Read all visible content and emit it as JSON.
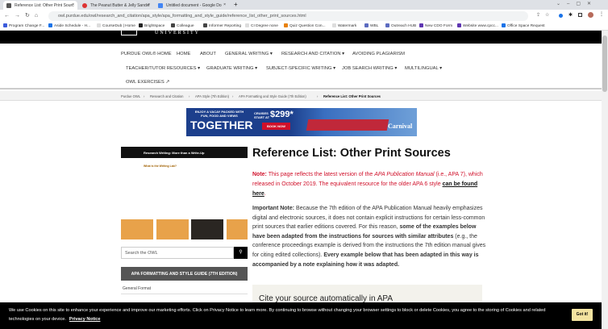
{
  "browser": {
    "tabs": [
      {
        "label": "Reference List: Other Print Sourc",
        "color": "#555"
      },
      {
        "label": "The Peanut Butter & Jelly Sandw",
        "color": "#d33"
      },
      {
        "label": "Untitled document - Google Do",
        "color": "#4285f4"
      }
    ],
    "url": "owl.purdue.edu/owl/research_and_citation/apa_style/apa_formatting_and_style_guide/reference_list_other_print_sources.html",
    "bookmarks": [
      "Program Change F...",
      "Aside Schedule - H...",
      "CourseDub | Home",
      "Brightspace",
      "Colleague",
      "Informer Reporting",
      "CI Degree none",
      "Quiz Question Con...",
      "Watermark",
      "WBL",
      "Outreach HUB",
      "New CDO Form",
      "Website www.cpcc...",
      "Office Space Request"
    ]
  },
  "header": {
    "logo": "UNIVERSITY"
  },
  "nav": {
    "row1": [
      "PURDUE OWL® HOME",
      "HOME",
      "ABOUT",
      "GENERAL WRITING ▾",
      "RESEARCH AND CITATION ▾",
      "AVOIDING PLAGIARISM"
    ],
    "row2": [
      "TEACHER/TUTOR RESOURCES ▾",
      "GRADUATE WRITING ▾",
      "SUBJECT-SPECIFIC WRITING ▾",
      "JOB SEARCH WRITING ▾",
      "MULTILINGUAL ▾"
    ],
    "row3": [
      "OWL EXERCISES ↗"
    ]
  },
  "breadcrumb": [
    "Purdue OWL",
    "Research and Citation",
    "APA Style (7th Edition)",
    "APA Formatting and Style Guide (7th Edition)",
    "Reference List: Other Print Sources"
  ],
  "ad": {
    "line1": "ENJOY A VACAY PACKED WITH FUN, FOOD AND VIEWS",
    "line2": "TOGETHER",
    "price_prefix": "CRUISES START AT",
    "price": "$299*",
    "cta": "BOOK NOW",
    "brand": "Carnival"
  },
  "sidebar": {
    "banner": "Research Writing: More than a Write-Up",
    "banner_sub": "What is the Writing Lab?",
    "search_placeholder": "Search the OWL",
    "section": "APA FORMATTING AND STYLE GUIDE (7TH EDITION)",
    "items": [
      "General Format"
    ]
  },
  "main": {
    "title": "Reference List: Other Print Sources",
    "note_label": "Note:",
    "note_text": " This page reflects the latest version of the ",
    "note_italic": "APA Publication Manual",
    "note_text2": " (i.e., APA 7), which released in October 2019. The equivalent resource for the older APA 6 style ",
    "note_link": "can be found here",
    "imp_label": "Important Note:",
    "imp1": " Because the 7th edition of the APA Publication Manual heavily emphasizes digital and electronic sources, it does not contain explicit instructions for certain less-common print sources that earlier editions covered. For this reason, ",
    "imp_bold1": "some of the examples below have been adapted from the instructions for sources with similar attributes",
    "imp2": " (e.g., the conference proceedings example is derived from the instructions the 7th edition manual gives for citing edited collections). ",
    "imp_bold2": "Every example below that has been adapted in this way is accompanied by a note explaining how it was adapted.",
    "cite_box": "Cite your source automatically in APA"
  },
  "cookie": {
    "text": "We use Cookies on this site to enhance your experience and improve our marketing efforts. Click on Privacy Notice to learn more. By continuing to browse without changing your browser settings to block or delete Cookies, you agree to the storing of Cookies and related technologies on your device.",
    "link": "Privacy Notice",
    "button": "Got it!"
  }
}
